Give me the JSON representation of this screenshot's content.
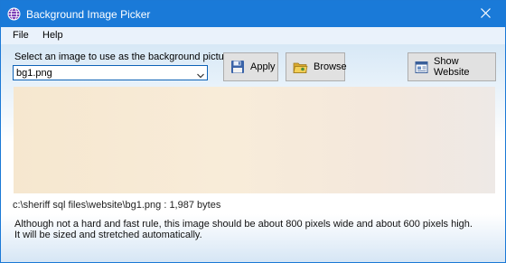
{
  "window": {
    "title": "Background Image Picker"
  },
  "menu": {
    "file": "File",
    "help": "Help"
  },
  "picker": {
    "prompt": "Select an image to use as the background picture",
    "selected": "bg1.png"
  },
  "buttons": {
    "apply": "Apply",
    "browse": "Browse",
    "show_website": "Show Website"
  },
  "info": {
    "file_details": "c:\\sheriff sql files\\website\\bg1.png : 1,987 bytes",
    "note_line1": "Although not a hard and fast rule, this image should be about 800 pixels wide and about 600 pixels high.",
    "note_line2": "It will be sized and stretched automatically."
  },
  "colors": {
    "titlebar": "#1a7ad8",
    "accent_border": "#0f63b7",
    "preview_tint": "#f6e7cf"
  },
  "icons": [
    "globe-icon",
    "close-icon",
    "chevron-down-icon",
    "floppy-disk-icon",
    "folder-icon",
    "website-icon"
  ]
}
